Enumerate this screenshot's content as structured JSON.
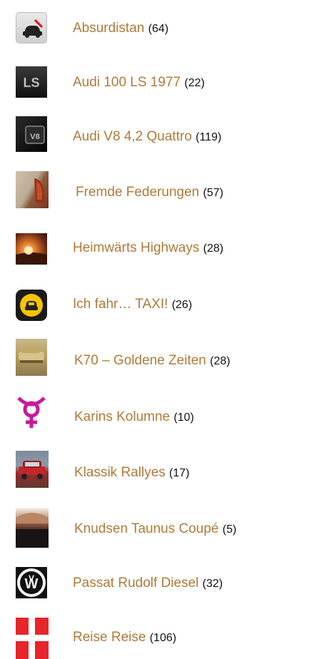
{
  "items": [
    {
      "label": "Absurdistan",
      "count": "64",
      "icon": "car-crossed-icon"
    },
    {
      "label": "Audi 100 LS 1977",
      "count": "22",
      "icon": "ls-emblem-icon"
    },
    {
      "label": "Audi V8 4,2 Quattro",
      "count": "119",
      "icon": "v8-badge-icon"
    },
    {
      "label": "Fremde Federungen",
      "count": "57",
      "icon": "taillight-icon"
    },
    {
      "label": "Heimwärts Highways",
      "count": "28",
      "icon": "sunset-road-icon"
    },
    {
      "label": "Ich fahr… TAXI!",
      "count": "26",
      "icon": "taxi-icon"
    },
    {
      "label": "K70 – Goldene Zeiten",
      "count": "28",
      "icon": "golden-car-icon"
    },
    {
      "label": "Karins Kolumne",
      "count": "10",
      "icon": "venus-symbol-icon"
    },
    {
      "label": "Klassik Rallyes",
      "count": "17",
      "icon": "red-rally-car-icon"
    },
    {
      "label": "Knudsen Taunus Coupé",
      "count": "5",
      "icon": "car-roof-icon"
    },
    {
      "label": "Passat Rudolf Diesel",
      "count": "32",
      "icon": "vw-logo-icon"
    },
    {
      "label": "Reise Reise",
      "count": "106",
      "icon": "danish-flag-icon"
    }
  ],
  "colors": {
    "link": "#b07a3a",
    "count": "#111111",
    "background": "#ffffff"
  }
}
